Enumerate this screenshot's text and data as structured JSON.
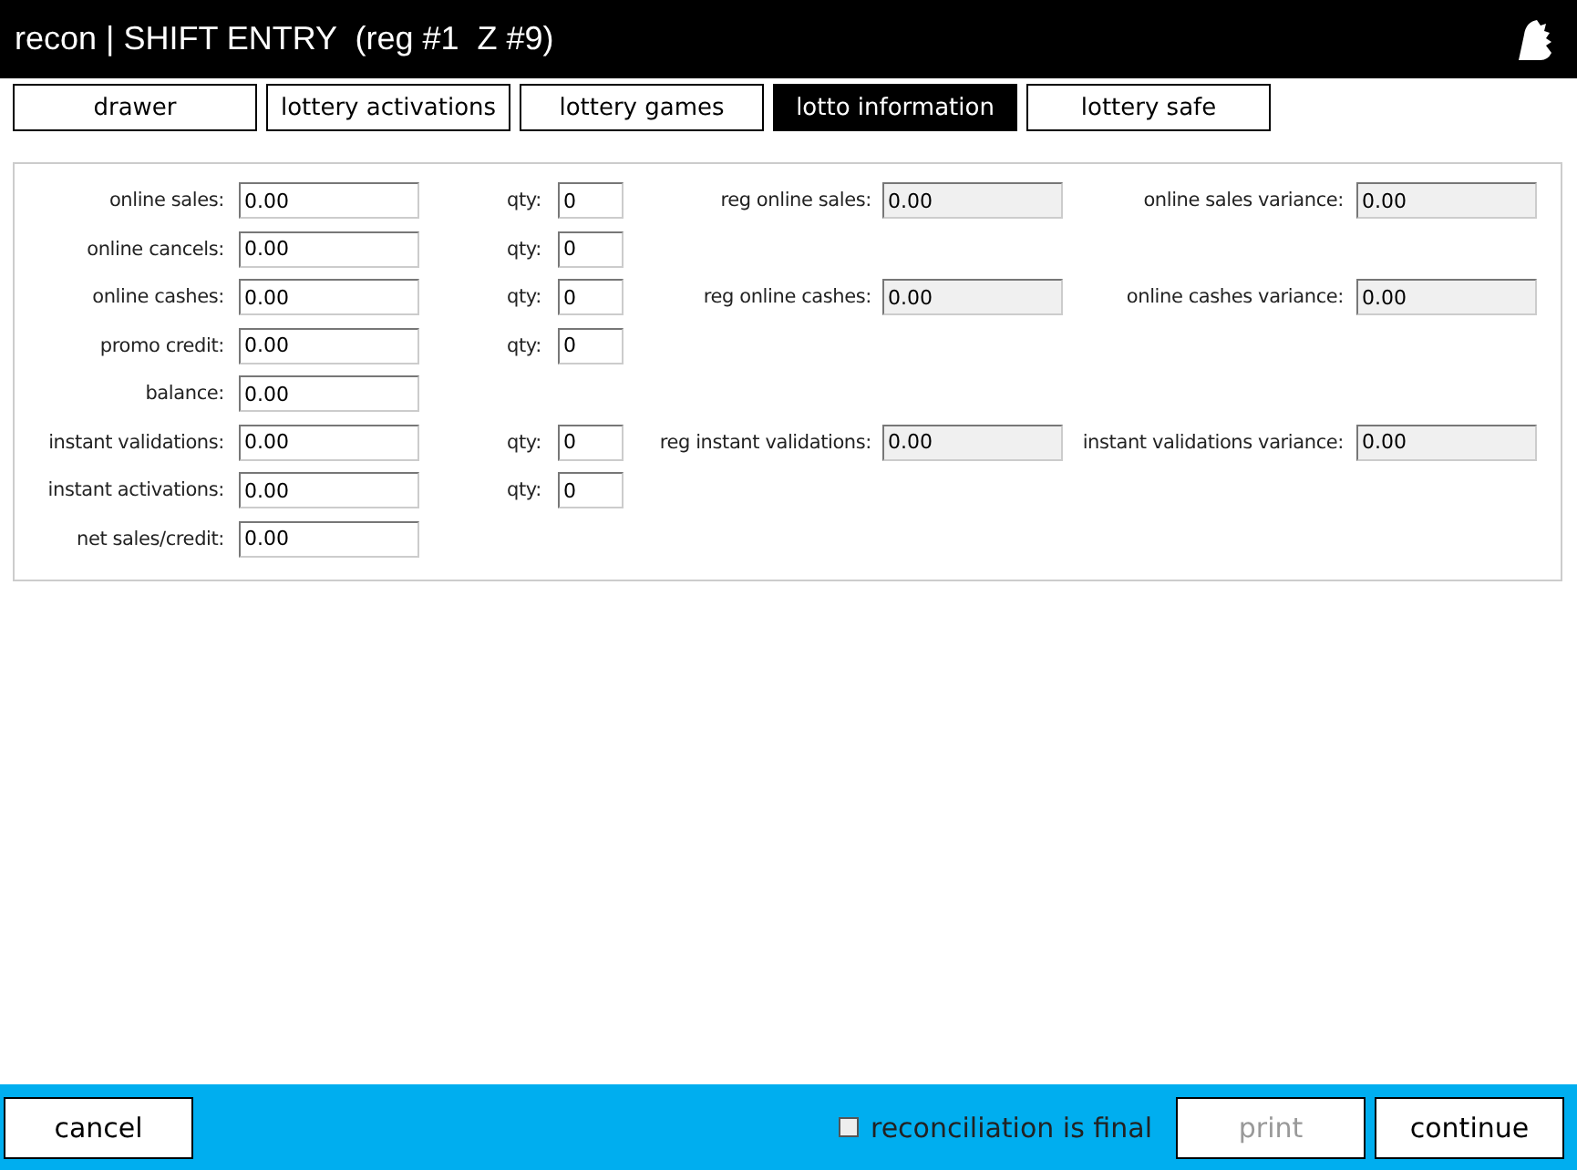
{
  "window": {
    "title": "recon | SHIFT ENTRY  (reg #1  Z #9)"
  },
  "tabs": [
    {
      "label": "drawer",
      "selected": false
    },
    {
      "label": "lottery activations",
      "selected": false
    },
    {
      "label": "lottery games",
      "selected": false
    },
    {
      "label": "lotto information",
      "selected": true
    },
    {
      "label": "lottery safe",
      "selected": false
    }
  ],
  "form_rows": [
    {
      "label": "online sales:",
      "value": "0.00",
      "qty": {
        "label": "qty:",
        "value": "0"
      },
      "reg": {
        "label": "reg online sales:",
        "value": "0.00",
        "disabled": true
      },
      "variance": {
        "label": "online sales variance:",
        "value": "0.00",
        "disabled": true
      }
    },
    {
      "label": "online cancels:",
      "value": "0.00",
      "qty": {
        "label": "qty:",
        "value": "0"
      }
    },
    {
      "label": "online cashes:",
      "value": "0.00",
      "qty": {
        "label": "qty:",
        "value": "0"
      },
      "reg": {
        "label": "reg online cashes:",
        "value": "0.00",
        "disabled": true
      },
      "variance": {
        "label": "online cashes variance:",
        "value": "0.00",
        "disabled": true
      }
    },
    {
      "label": "promo credit:",
      "value": "0.00",
      "qty": {
        "label": "qty:",
        "value": "0"
      }
    },
    {
      "label": "balance:",
      "value": "0.00"
    },
    {
      "label": "instant validations:",
      "value": "0.00",
      "qty": {
        "label": "qty:",
        "value": "0"
      },
      "reg": {
        "label": "reg instant validations:",
        "value": "0.00",
        "disabled": true
      },
      "variance": {
        "label": "instant validations variance:",
        "value": "0.00",
        "disabled": true
      }
    },
    {
      "label": "instant activations:",
      "value": "0.00",
      "qty": {
        "label": "qty:",
        "value": "0"
      }
    },
    {
      "label": "net sales/credit:",
      "value": "0.00"
    }
  ],
  "footer": {
    "cancel": {
      "label": "cancel",
      "disabled": false
    },
    "final_checkbox": {
      "label": "reconciliation is final",
      "checked": false
    },
    "print": {
      "label": "print",
      "disabled": true
    },
    "continue": {
      "label": "continue",
      "disabled": false
    }
  }
}
